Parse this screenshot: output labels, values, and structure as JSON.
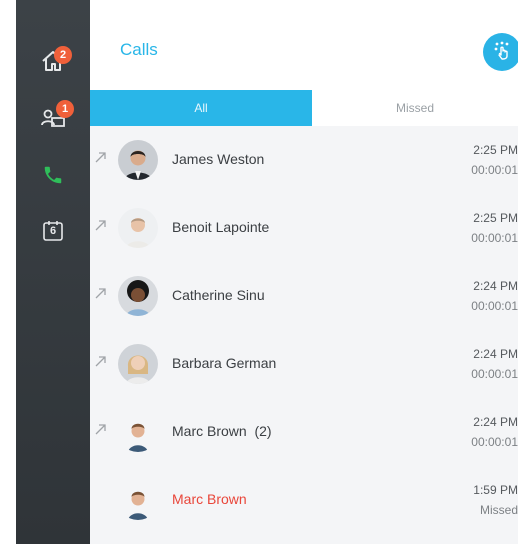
{
  "sidebar": {
    "items": [
      {
        "name": "home",
        "icon": "home-icon",
        "badge": "2"
      },
      {
        "name": "contacts",
        "icon": "contacts-icon",
        "badge": "1"
      },
      {
        "name": "calls",
        "icon": "phone-icon",
        "badge": null,
        "active_color": "#2fbe5a"
      },
      {
        "name": "calendar",
        "icon": "calendar-icon",
        "day": "6"
      }
    ]
  },
  "header": {
    "title": "Calls",
    "action_icon": "touch-dial-icon"
  },
  "tabs": [
    {
      "label": "All",
      "active": true
    },
    {
      "label": "Missed",
      "active": false
    }
  ],
  "calls": [
    {
      "name": "James Weston",
      "time": "2:25 PM",
      "detail": "00:00:01",
      "outgoing": true,
      "missed": false
    },
    {
      "name": "Benoit Lapointe",
      "time": "2:25 PM",
      "detail": "00:00:01",
      "outgoing": true,
      "missed": false
    },
    {
      "name": "Catherine Sinu",
      "time": "2:24 PM",
      "detail": "00:00:01",
      "outgoing": true,
      "missed": false
    },
    {
      "name": "Barbara German",
      "time": "2:24 PM",
      "detail": "00:00:01",
      "outgoing": true,
      "missed": false
    },
    {
      "name": "Marc Brown  (2)",
      "time": "2:24 PM",
      "detail": "00:00:01",
      "outgoing": true,
      "missed": false
    },
    {
      "name": "Marc Brown",
      "time": "1:59 PM",
      "detail": "Missed",
      "outgoing": false,
      "missed": true
    }
  ],
  "colors": {
    "accent": "#29b6e8",
    "badge": "#f0603a",
    "missed": "#e9463a",
    "sidebar": "#353a3f"
  }
}
